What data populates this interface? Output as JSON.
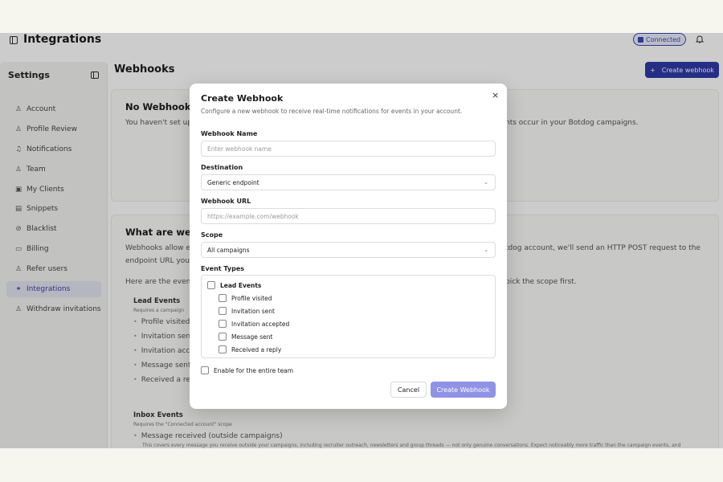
{
  "header": {
    "title": "Integrations",
    "status_badge": "Connected",
    "status_badge_icon": "linkedin-icon"
  },
  "sidebar": {
    "title": "Settings",
    "items": [
      {
        "label": "Account",
        "icon": "user-icon",
        "glyph": "♙"
      },
      {
        "label": "Profile Review",
        "icon": "user-check-icon",
        "glyph": "♙"
      },
      {
        "label": "Notifications",
        "icon": "bell-icon",
        "glyph": "♫"
      },
      {
        "label": "Team",
        "icon": "users-icon",
        "glyph": "♙"
      },
      {
        "label": "My Clients",
        "icon": "briefcase-icon",
        "glyph": "▣"
      },
      {
        "label": "Snippets",
        "icon": "file-icon",
        "glyph": "▤"
      },
      {
        "label": "Blacklist",
        "icon": "ban-icon",
        "glyph": "⊘"
      },
      {
        "label": "Billing",
        "icon": "credit-card-icon",
        "glyph": "▭"
      },
      {
        "label": "Refer users",
        "icon": "user-plus-icon",
        "glyph": "♙"
      },
      {
        "label": "Integrations",
        "icon": "link-icon",
        "glyph": "⚭",
        "active": true
      },
      {
        "label": "Withdraw invitations",
        "icon": "user-minus-icon",
        "glyph": "♙"
      }
    ]
  },
  "main": {
    "title": "Webhooks",
    "create_button": "Create webhook",
    "empty": {
      "title": "No Webhooks",
      "text_left": "You haven't set up",
      "text_right": "nts occur in your Botdog campaigns."
    },
    "about": {
      "title": "What are webh",
      "line1_left": "Webhooks allow ex",
      "line1_right": "tdog account, we'll send an HTTP POST request to the",
      "line2_left": "endpoint URL you",
      "line3_left": "Here are the even",
      "line3_right": "pick the scope first.",
      "lead_title": "Lead Events",
      "lead_note": "Requires a campaign",
      "lead_items": [
        "Profile visited",
        "Invitation sent",
        "Invitation acce",
        "Message sent",
        "Received a rep"
      ],
      "inbox_title": "Inbox Events",
      "inbox_note": "Requires the \"Connected account\" scope",
      "inbox_item": "Message received (outside campaigns)",
      "inbox_item_note": "This covers every message you receive outside your campaigns, including recruiter outreach, newsletters and group threads — not only genuine conversations. Expect noticeably more traffic than the campaign events, and"
    }
  },
  "modal": {
    "title": "Create Webhook",
    "description": "Configure a new webhook to receive real-time notifications for events in your account.",
    "name_label": "Webhook Name",
    "name_placeholder": "Enter webhook name",
    "destination_label": "Destination",
    "destination_value": "Generic endpoint",
    "url_label": "Webhook URL",
    "url_placeholder": "https://example.com/webhook",
    "scope_label": "Scope",
    "scope_value": "All campaigns",
    "event_types_label": "Event Types",
    "lead_events_label": "Lead Events",
    "events": [
      "Profile visited",
      "Invitation sent",
      "Invitation accepted",
      "Message sent",
      "Received a reply"
    ],
    "team_label": "Enable for the entire team",
    "cancel_label": "Cancel",
    "submit_label": "Create Webhook",
    "close_glyph": "×"
  }
}
